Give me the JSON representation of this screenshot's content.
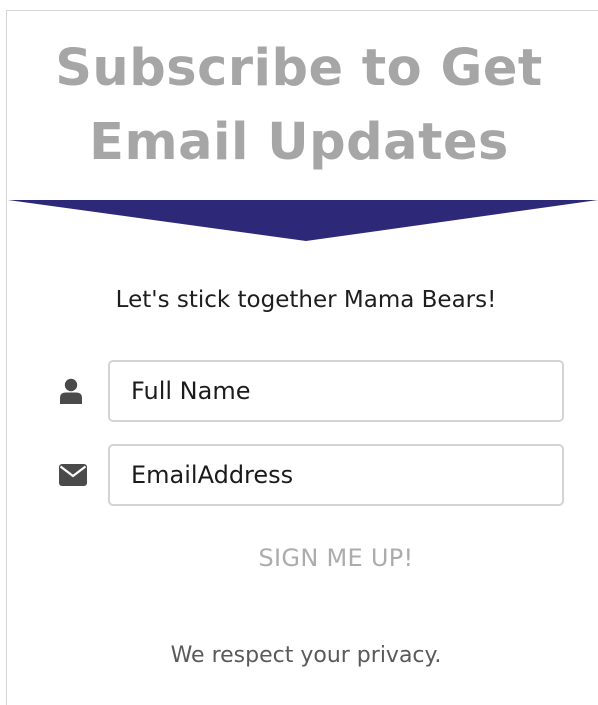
{
  "header": {
    "title_line1": "Subscribe to Get",
    "title_line2": "Email Updates"
  },
  "banner": {
    "color": "#2e2878"
  },
  "tagline": "Let's stick together Mama Bears!",
  "form": {
    "name_field": {
      "icon": "user-icon",
      "placeholder": "Full Name",
      "value": ""
    },
    "email_field": {
      "icon": "envelope-icon",
      "placeholder": "EmailAddress",
      "value": ""
    },
    "submit_label": "SIGN ME UP!"
  },
  "privacy_note": "We respect your privacy.",
  "colors": {
    "title": "#a6a6a6",
    "icon": "#4a4a4a",
    "input_border": "#d4d4d4",
    "submit_text": "#acacac"
  }
}
